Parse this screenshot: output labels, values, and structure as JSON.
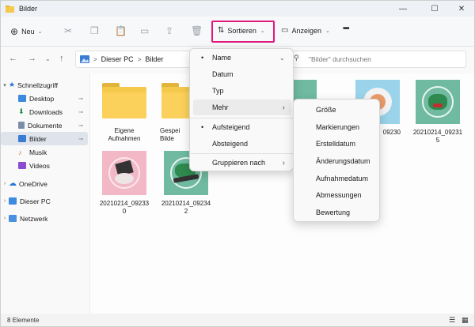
{
  "window": {
    "title": "Bilder"
  },
  "toolbar": {
    "new_label": "Neu",
    "sort_label": "Sortieren",
    "view_label": "Anzeigen",
    "more_label": "•••"
  },
  "address": {
    "segments": [
      "Dieser PC",
      "Bilder"
    ],
    "separator": ">",
    "search_placeholder": "\"Bilder\" durchsuchen"
  },
  "sidebar": {
    "items": [
      {
        "label": "Schnellzugriff",
        "chevron": "▾"
      },
      {
        "label": "Desktop",
        "pin": "📌"
      },
      {
        "label": "Downloads",
        "pin": "📌"
      },
      {
        "label": "Dokumente",
        "pin": "📌"
      },
      {
        "label": "Bilder",
        "pin": "📌"
      },
      {
        "label": "Musik"
      },
      {
        "label": "Videos"
      },
      {
        "label": "OneDrive",
        "chevron": "›"
      },
      {
        "label": "Dieser PC",
        "chevron": "›"
      },
      {
        "label": "Netzwerk",
        "chevron": "›"
      }
    ]
  },
  "files": [
    {
      "name": "Eigene Aufnahmen",
      "type": "folder"
    },
    {
      "name": "Gespeicherte Bilder",
      "label_visible": "Gespei\nBilde",
      "type": "folder"
    },
    {
      "name": "20210214_09230",
      "type": "image",
      "bg": "#6fbaa0"
    },
    {
      "name": "20210214_09231 5",
      "label_visible": "20210214_09231\n5",
      "type": "image",
      "bg": "#6fbaa0"
    },
    {
      "name": "20210214_092330",
      "label_visible": "20210214_09233\n0",
      "type": "image",
      "bg": "#f2b8c6"
    },
    {
      "name": "20210214_092342",
      "label_visible": "20210214_09234\n2",
      "type": "image",
      "bg": "#6fbaa0"
    },
    {
      "name": "...09230",
      "label_visible": "09230",
      "type": "image",
      "bg": "#9ad3ea"
    }
  ],
  "status": {
    "count": "8 Elemente"
  },
  "sort_menu": {
    "items": [
      {
        "label": "Name",
        "bullet": "•"
      },
      {
        "label": "Datum"
      },
      {
        "label": "Typ"
      },
      {
        "label": "Mehr",
        "arrow": "›"
      },
      {
        "label": "Aufsteigend",
        "bullet": "•"
      },
      {
        "label": "Absteigend"
      },
      {
        "label": "Gruppieren nach",
        "arrow": "›"
      }
    ]
  },
  "more_menu": {
    "items": [
      "Größe",
      "Markierungen",
      "Erstelldatum",
      "Änderungsdatum",
      "Aufnahmedatum",
      "Abmessungen",
      "Bewertung"
    ]
  },
  "colors": {
    "accent": "#e0197d",
    "folder": "#f4c94c",
    "selection": "#dfe4ec"
  }
}
